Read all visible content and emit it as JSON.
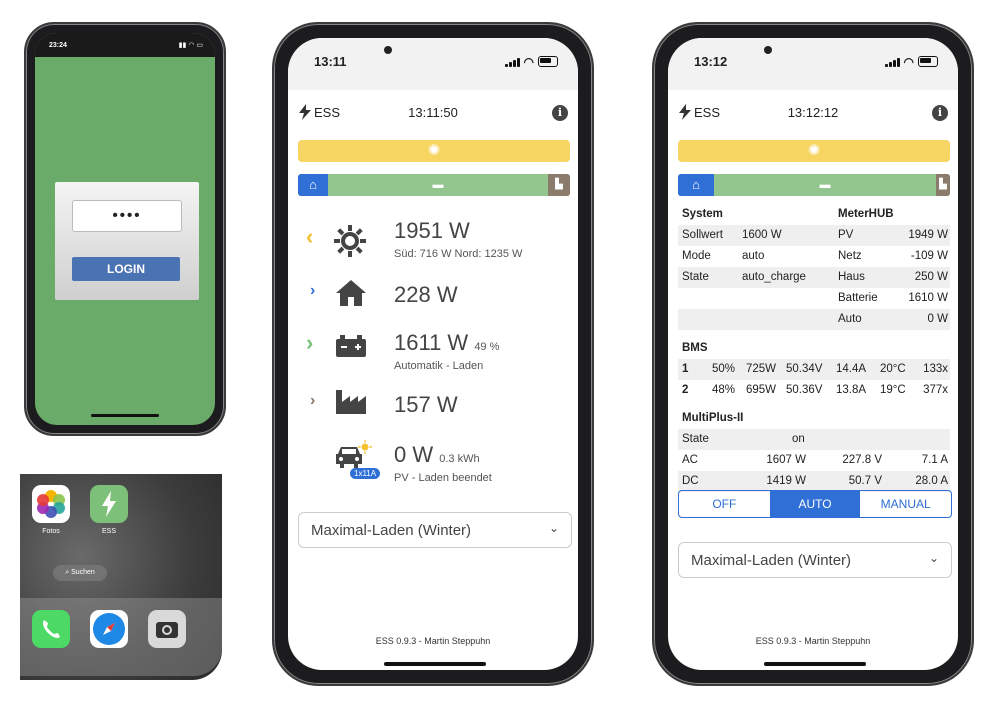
{
  "login_phone": {
    "status_time": "23:24",
    "password_mask": "••••",
    "login_label": "LOGIN"
  },
  "home_screen": {
    "apps": [
      {
        "label": "Fotos"
      },
      {
        "label": "ESS"
      }
    ],
    "search_label": "Suchen",
    "dock": [
      "phone",
      "safari",
      "camera"
    ]
  },
  "phone2": {
    "status_time": "13:11",
    "app_name": "ESS",
    "clock": "13:11:50",
    "rows": {
      "solar": {
        "value": "1951 W",
        "detail": "Süd: 716 W Nord: 1235 W"
      },
      "house": {
        "value": "228 W"
      },
      "battery": {
        "value": "1611 W",
        "percent": "49 %",
        "detail": "Automatik - Laden"
      },
      "grid": {
        "value": "157 W"
      },
      "car": {
        "value": "0 W",
        "energy": "0.3 kWh",
        "badge": "1x11A",
        "detail": "PV - Laden beendet"
      }
    },
    "mode_select": "Maximal-Laden (Winter)",
    "footer": "ESS 0.9.3 - Martin Steppuhn"
  },
  "phone3": {
    "status_time": "13:12",
    "app_name": "ESS",
    "clock": "13:12:12",
    "system": {
      "title": "System",
      "rows": [
        {
          "key": "Sollwert",
          "value": "1600 W"
        },
        {
          "key": "Mode",
          "value": "auto"
        },
        {
          "key": "State",
          "value": "auto_charge"
        }
      ]
    },
    "meterhub": {
      "title": "MeterHUB",
      "rows": [
        {
          "key": "PV",
          "value": "1949 W"
        },
        {
          "key": "Netz",
          "value": "-109 W"
        },
        {
          "key": "Haus",
          "value": "250 W"
        },
        {
          "key": "Batterie",
          "value": "1610 W"
        },
        {
          "key": "Auto",
          "value": "0 W"
        }
      ]
    },
    "bms": {
      "title": "BMS",
      "rows": [
        {
          "id": "1",
          "soc": "50%",
          "power": "725W",
          "voltage": "50.34V",
          "current": "14.4A",
          "temp": "20°C",
          "cycles": "133x"
        },
        {
          "id": "2",
          "soc": "48%",
          "power": "695W",
          "voltage": "50.36V",
          "current": "13.8A",
          "temp": "19°C",
          "cycles": "377x"
        }
      ]
    },
    "multiplus": {
      "title": "MultiPlus-II",
      "rows": [
        {
          "key": "State",
          "a": "on",
          "b": "",
          "c": ""
        },
        {
          "key": "AC",
          "a": "1607 W",
          "b": "227.8 V",
          "c": "7.1 A"
        },
        {
          "key": "DC",
          "a": "1419 W",
          "b": "50.7 V",
          "c": "28.0 A"
        }
      ]
    },
    "mode_buttons": [
      "OFF",
      "AUTO",
      "MANUAL"
    ],
    "active_mode": "AUTO",
    "mode_select": "Maximal-Laden (Winter)",
    "footer": "ESS 0.9.3 - Martin Steppuhn"
  },
  "colors": {
    "sun": "#f7d563",
    "flow_green": "#93c68f",
    "home_blue": "#2f6fd6",
    "grid_brown": "#8b7b6b",
    "login_green": "#6aab69"
  }
}
